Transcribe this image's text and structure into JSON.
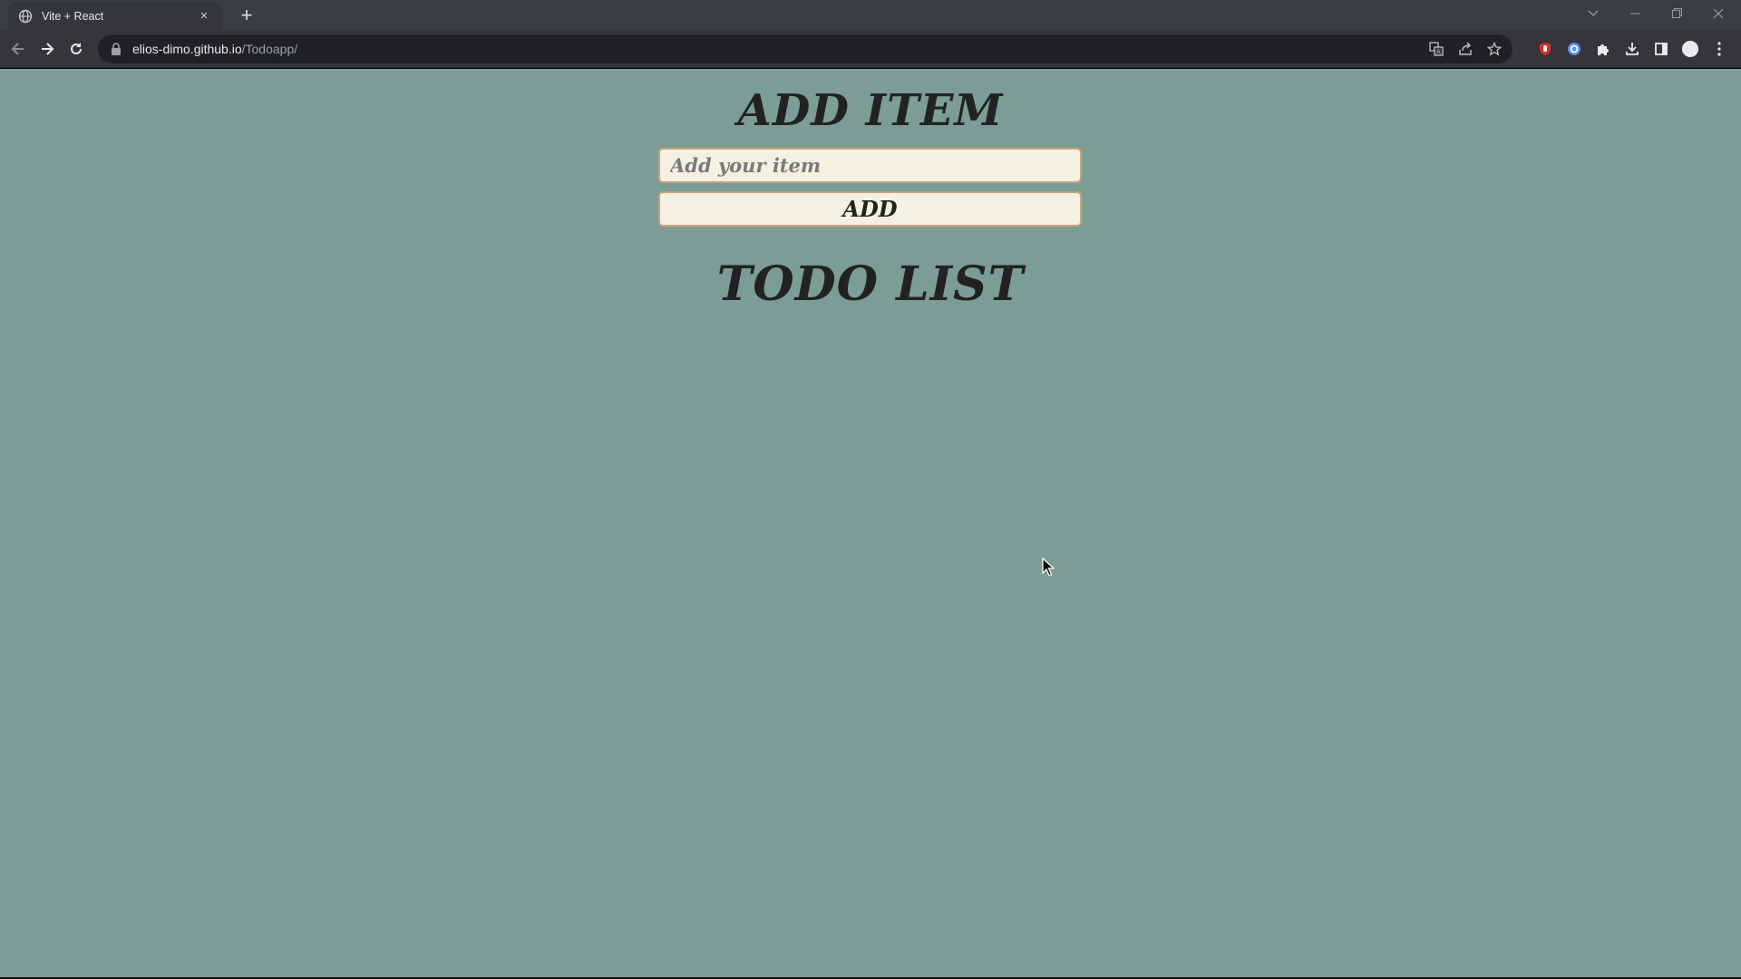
{
  "browser": {
    "tab_title": "Vite + React",
    "tab_close_glyph": "×",
    "new_tab_glyph": "+",
    "url_domain": "elios-dimo.github.io",
    "url_path": "/Todoapp/",
    "icons": {
      "favicon": "globe-icon",
      "back": "back-arrow-icon",
      "forward": "forward-arrow-icon",
      "reload": "reload-icon",
      "lock": "lock-icon",
      "translate": "translate-icon",
      "share": "share-icon",
      "bookmark": "star-icon",
      "extensions": [
        "red-shield-extension-icon",
        "blue-circle-extension-icon",
        "puzzle-extensions-icon"
      ],
      "download": "download-icon",
      "side_panel": "side-panel-icon",
      "profile": "profile-avatar-icon",
      "menu": "kebab-menu-icon"
    }
  },
  "app": {
    "add_heading": "ADD ITEM",
    "input_placeholder": "Add your item",
    "input_value": "",
    "add_button_label": "ADD",
    "todo_heading": "TODO LIST",
    "todo_items": []
  },
  "colors": {
    "page_background": "#7c9d96",
    "field_background": "#f3f1e1",
    "field_border": "#c8a27a",
    "heading_text": "#222222"
  }
}
